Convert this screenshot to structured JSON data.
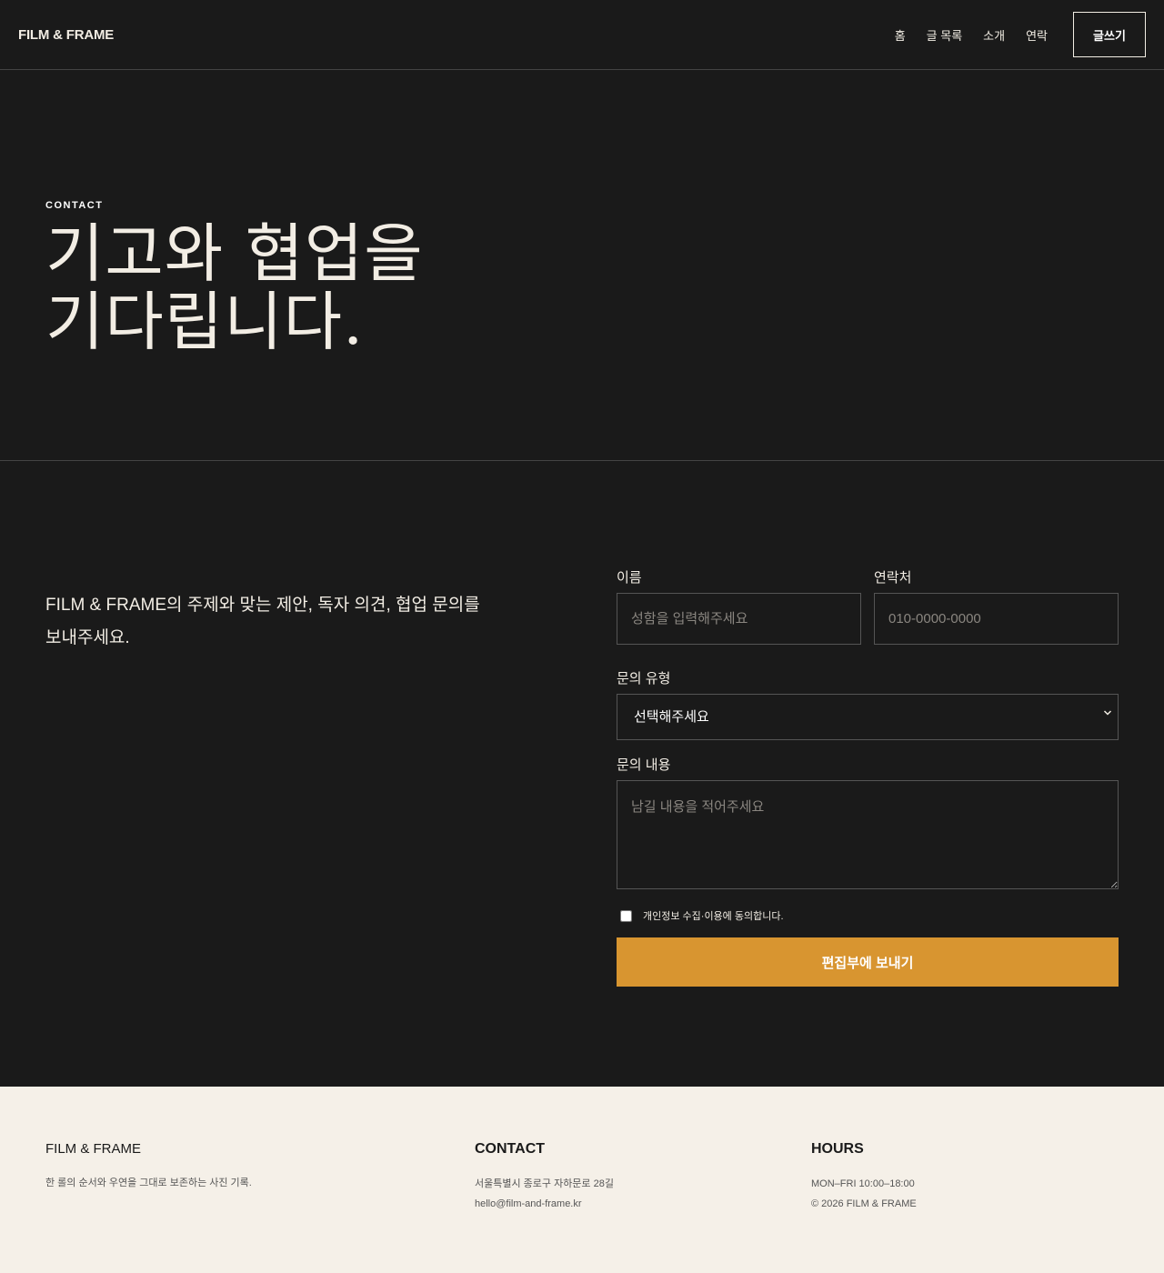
{
  "header": {
    "brand": "FILM & FRAME",
    "nav": [
      "홈",
      "글 목록",
      "소개",
      "연락"
    ],
    "write_button": "글쓰기"
  },
  "hero": {
    "eyebrow": "CONTACT",
    "title_line1": "기고와 협업을",
    "title_line2": "기다립니다."
  },
  "intro": {
    "text": "FILM & FRAME의 주제와 맞는 제안, 독자 의견, 협업 문의를 보내주세요."
  },
  "form": {
    "name_label": "이름",
    "name_placeholder": "성함을 입력해주세요",
    "phone_label": "연락처",
    "phone_placeholder": "010-0000-0000",
    "type_label": "문의 유형",
    "type_selected": "선택해주세요",
    "message_label": "문의 내용",
    "message_placeholder": "남길 내용을 적어주세요",
    "consent_label": "개인정보 수집·이용에 동의합니다.",
    "submit_label": "편집부에 보내기"
  },
  "footer": {
    "brand_title": "FILM & FRAME",
    "brand_desc": "한 롤의 순서와 우연을 그대로 보존하는 사진 기록.",
    "contact_title": "CONTACT",
    "address": "서울특별시 종로구 자하문로 28길",
    "email": "hello@film-and-frame.kr",
    "hours_title": "HOURS",
    "hours": "MON–FRI 10:00–18:00",
    "copyright": "© 2026 FILM & FRAME"
  },
  "colors": {
    "background": "#1a1a1a",
    "text": "#f2ede4",
    "accent": "#d89530",
    "footer_background": "#f5f0e8"
  },
  "icons": {
    "select_arrow": "chevron-down-icon"
  }
}
